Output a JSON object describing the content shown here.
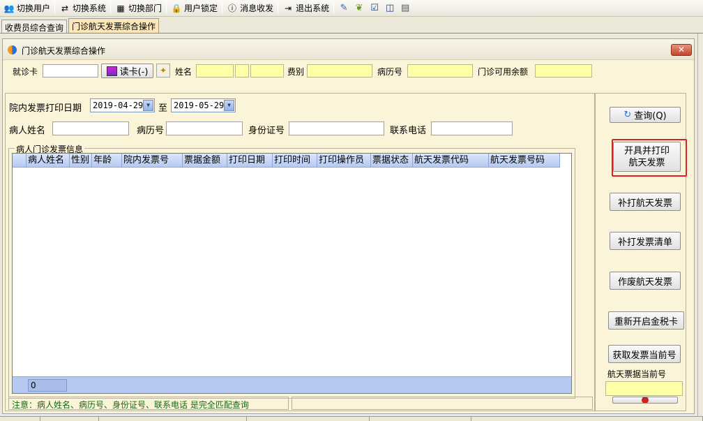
{
  "toolbar": {
    "items": [
      {
        "label": "切换用户",
        "icon": "switch-user-icon",
        "glyph": "👥"
      },
      {
        "label": "切换系统",
        "icon": "switch-system-icon",
        "glyph": "⇄"
      },
      {
        "label": "切换部门",
        "icon": "switch-department-icon",
        "glyph": "▦"
      },
      {
        "label": "用户锁定",
        "icon": "lock-user-icon",
        "glyph": "🔒"
      },
      {
        "label": "消息收发",
        "icon": "info-icon",
        "glyph": "ⓘ"
      },
      {
        "label": "退出系统",
        "icon": "exit-icon",
        "glyph": "⇥"
      }
    ],
    "extra_icons": [
      "edit-icon",
      "medal-icon",
      "checkbox-icon",
      "columns-icon",
      "window-icon"
    ]
  },
  "tabs": [
    {
      "label": "收费员综合查询",
      "active": false
    },
    {
      "label": "门诊航天发票综合操作",
      "active": true
    }
  ],
  "dialog": {
    "title": "门诊航天发票综合操作",
    "close_label": "✕",
    "card_row": {
      "card_label": "就诊卡",
      "card_value": "",
      "read_card_label": "读卡(-)",
      "name_label": "姓名",
      "fee_type_label": "费别",
      "record_no_label": "病历号",
      "balance_label": "门诊可用余额"
    },
    "query": {
      "date_label": "院内发票打印日期",
      "date_from": "2019-04-29",
      "to_label": "至",
      "date_to": "2019-05-29",
      "patient_name_label": "病人姓名",
      "record_no_label": "病历号",
      "id_label": "身份证号",
      "phone_label": "联系电话"
    },
    "group_title": "病人门诊发票信息",
    "grid": {
      "columns": [
        "病人姓名",
        "性别",
        "年龄",
        "院内发票号",
        "票据金额",
        "打印日期",
        "打印时间",
        "打印操作员",
        "票据状态",
        "航天发票代码",
        "航天发票号码"
      ],
      "rows": [],
      "count": "0"
    },
    "status_note": "注意：病人姓名、病历号、身份证号、联系电话 是完全匹配查询",
    "buttons": {
      "query": "查询(Q)",
      "issue_print_line1": "开具并打印",
      "issue_print_line2": "航天发票",
      "reprint": "补打航天发票",
      "reprint_list": "补打发票清单",
      "void": "作废航天发票",
      "restart_tax": "重新开启金税卡",
      "get_current": "获取发票当前号",
      "current_no_label": "航天票据当前号",
      "current_no_value": ""
    },
    "highlight_color": "#e02020"
  },
  "statusbar": {
    "cells": [
      "",
      "",
      "",
      "",
      "",
      ""
    ]
  }
}
